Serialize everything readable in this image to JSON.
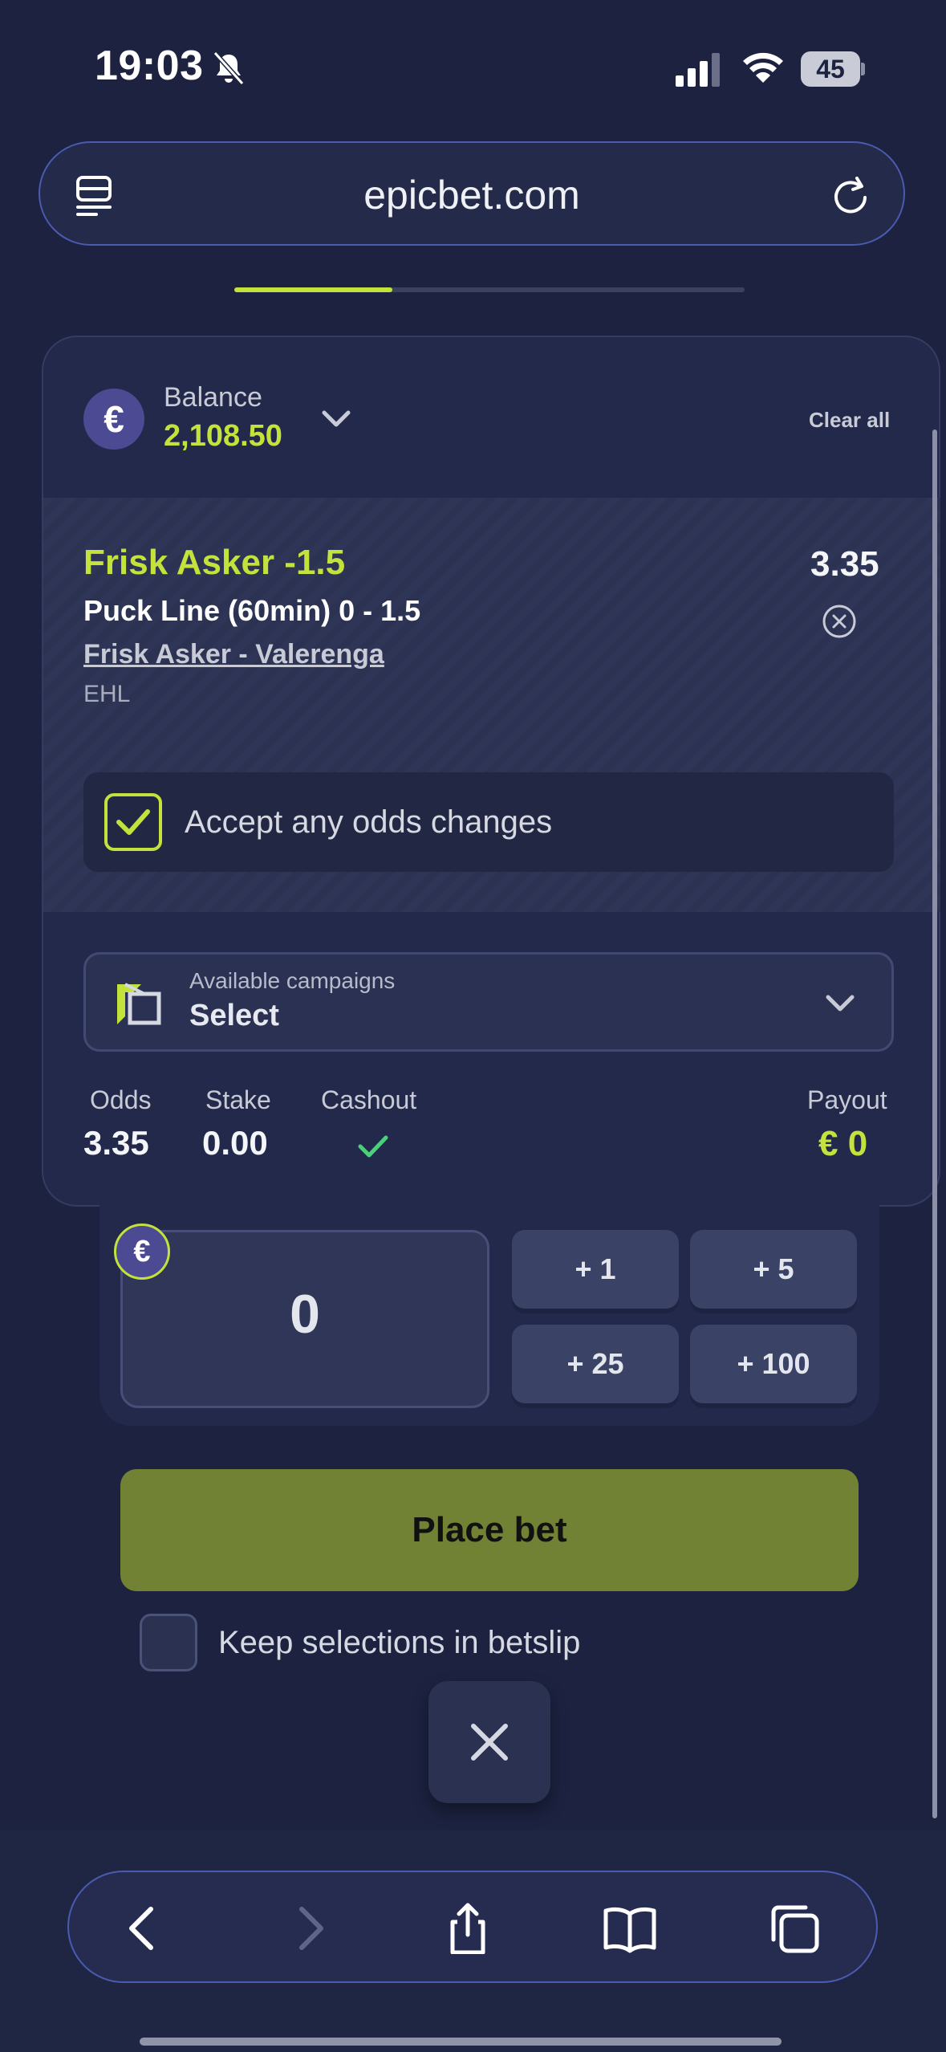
{
  "status_bar": {
    "time": "19:03",
    "battery": "45"
  },
  "browser": {
    "url": "epicbet.com",
    "load_progress": 0.31
  },
  "betslip": {
    "balance_label": "Balance",
    "balance_value": "2,108.50",
    "currency_symbol": "€",
    "clear_all_label": "Clear all",
    "selection": {
      "title": "Frisk Asker -1.5",
      "odds": "3.35",
      "market": "Puck Line (60min) 0 - 1.5",
      "event": "Frisk Asker - Valerenga",
      "league": "EHL"
    },
    "accept_odds": {
      "label": "Accept any odds changes",
      "checked": true
    },
    "campaigns": {
      "label": "Available campaigns",
      "value": "Select"
    },
    "summary": {
      "odds_label": "Odds",
      "odds_value": "3.35",
      "stake_label": "Stake",
      "stake_value": "0.00",
      "cashout_label": "Cashout",
      "payout_label": "Payout",
      "payout_value": "€  0"
    },
    "stake_input_value": "0",
    "quick_stakes": [
      "+ 1",
      "+ 5",
      "+ 25",
      "+ 100"
    ],
    "place_bet_label": "Place bet",
    "keep_selections": {
      "label": "Keep selections in betslip",
      "checked": false
    }
  },
  "toolbar": {
    "items": [
      "back-icon",
      "forward-icon",
      "share-icon",
      "bookmarks-icon",
      "tabs-icon"
    ]
  },
  "colors": {
    "accent": "#c4e23c",
    "background": "#1c2240",
    "card": "#23294a",
    "place_bet": "#728234",
    "euro_badge": "#4c4a93"
  }
}
